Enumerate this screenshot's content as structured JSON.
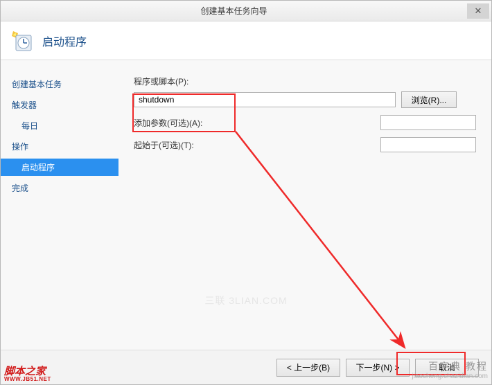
{
  "titlebar": {
    "title": "创建基本任务向导"
  },
  "header": {
    "title": "启动程序"
  },
  "sidebar": {
    "items": [
      {
        "label": "创建基本任务",
        "indent": false,
        "selected": false
      },
      {
        "label": "触发器",
        "indent": false,
        "selected": false
      },
      {
        "label": "每日",
        "indent": true,
        "selected": false
      },
      {
        "label": "操作",
        "indent": false,
        "selected": false
      },
      {
        "label": "启动程序",
        "indent": true,
        "selected": true
      },
      {
        "label": "完成",
        "indent": false,
        "selected": false
      }
    ]
  },
  "form": {
    "program_label": "程序或脚本(P):",
    "program_value": "shutdown",
    "browse_label": "浏览(R)...",
    "args_label": "添加参数(可选)(A):",
    "args_value": "",
    "startin_label": "起始于(可选)(T):",
    "startin_value": ""
  },
  "footer": {
    "back": "< 上一步(B)",
    "next": "下一步(N) >",
    "cancel": "取消"
  },
  "watermarks": {
    "left_main": "脚本之家",
    "left_sub": "WWW.JB51.NET",
    "center": "三联 3LIAN.COM",
    "right_main": "百字典 教程",
    "right_sub": "jiaocheng.chazidian.com"
  }
}
